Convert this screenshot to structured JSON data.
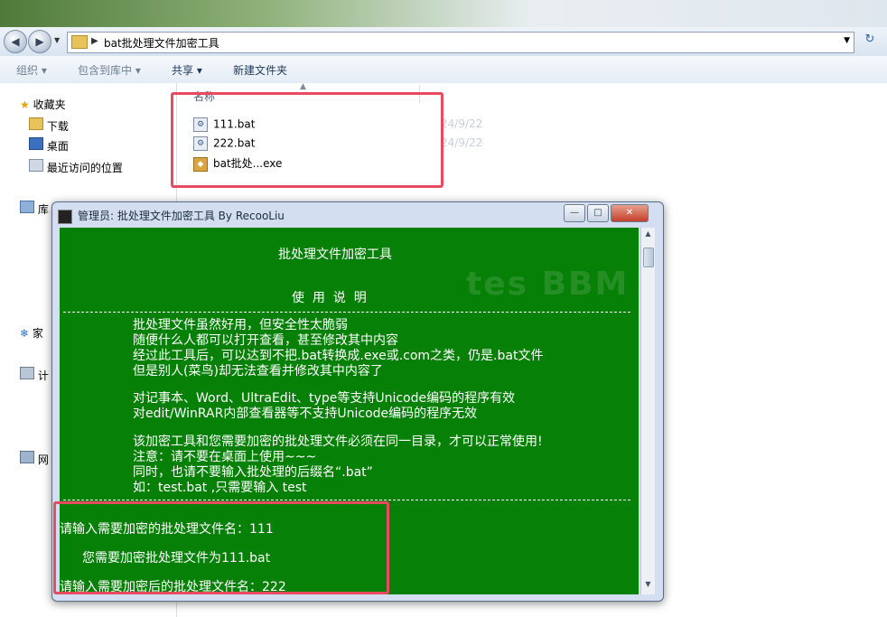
{
  "explorer": {
    "address_path": "bat批处理文件加密工具",
    "toolbar": [
      "组织",
      "包含到库中",
      "共享",
      "新建文件夹"
    ],
    "nav": {
      "favorites": "收藏夹",
      "downloads": "下载",
      "desktop": "桌面",
      "recent": "最近访问的位置",
      "libraries": "库",
      "homegroup": "家",
      "computer": "计",
      "network": "网"
    },
    "column_name": "名称",
    "files": [
      {
        "name": "111.bat",
        "date": "24/9/22"
      },
      {
        "name": "222.bat",
        "date": "24/9/22"
      },
      {
        "name": "bat批处...exe",
        "date": ""
      }
    ]
  },
  "console_window": {
    "title": "管理员:  批处理文件加密工具 By RecooLiu",
    "header": "批处理文件加密工具",
    "usage_title": "使  用  说  明",
    "lines": [
      "批处理文件虽然好用，但安全性太脆弱",
      "随便什么人都可以打开查看，甚至修改其中内容",
      "经过此工具后，可以达到不把.bat转换成.exe或.com之类，仍是.bat文件",
      "但是别人(菜鸟)却无法查看并修改其中内容了",
      "对记事本、Word、UltraEdit、type等支持Unicode编码的程序有效",
      "对edit/WinRAR内部查看器等不支持Unicode编码的程序无效",
      "该加密工具和您需要加密的批处理文件必须在同一目录，才可以正常使用!",
      "注意：请不要在桌面上使用~~~",
      "同时，也请不要输入批处理的后缀名“.bat”",
      "如：test.bat ,只需要输入 test"
    ],
    "prompt1": "请输入需要加密的批处理文件名：111",
    "confirm": "您需要加密批处理文件为111.bat",
    "prompt2": "请输入需要加密后的批处理文件名：222",
    "bg_color": "#078007"
  }
}
